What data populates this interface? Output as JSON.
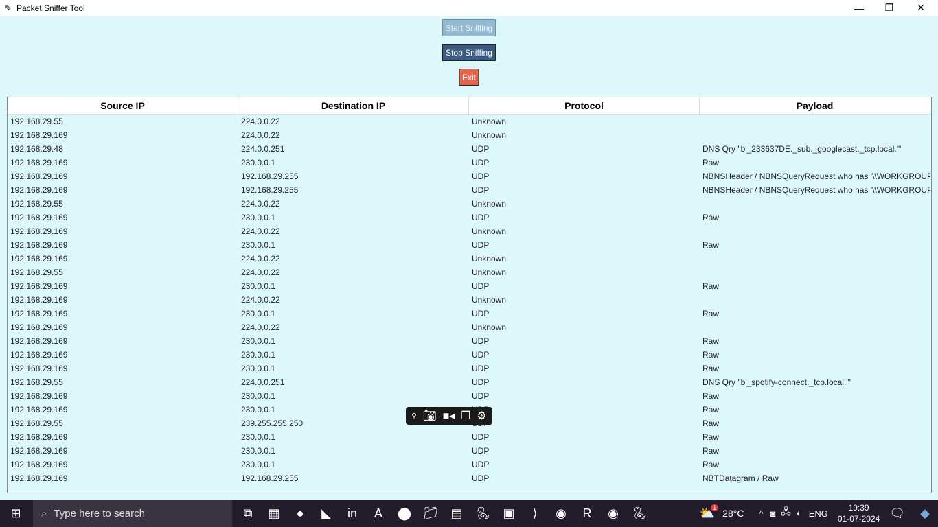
{
  "window": {
    "title": "Packet Sniffer Tool",
    "minimize": "—",
    "maximize": "❐",
    "close": "✕"
  },
  "buttons": {
    "start": "Start Sniffing",
    "stop": "Stop Sniffing",
    "exit": "Exit"
  },
  "colors": {
    "background": "#ddf8fb",
    "start": "#93bad3",
    "stop": "#3d5b80",
    "exit": "#e8654d"
  },
  "table": {
    "headers": [
      "Source IP",
      "Destination IP",
      "Protocol",
      "Payload"
    ],
    "rows": [
      [
        "192.168.29.55",
        "224.0.0.22",
        "Unknown",
        ""
      ],
      [
        "192.168.29.169",
        "224.0.0.22",
        "Unknown",
        ""
      ],
      [
        "192.168.29.48",
        "224.0.0.251",
        "UDP",
        "DNS Qry \"b'_233637DE._sub._googlecast._tcp.local.'\""
      ],
      [
        "192.168.29.169",
        "230.0.0.1",
        "UDP",
        "Raw"
      ],
      [
        "192.168.29.169",
        "192.168.29.255",
        "UDP",
        "NBNSHeader / NBNSQueryRequest who has '\\\\WORKGROUP'"
      ],
      [
        "192.168.29.169",
        "192.168.29.255",
        "UDP",
        "NBNSHeader / NBNSQueryRequest who has '\\\\WORKGROUP'"
      ],
      [
        "192.168.29.55",
        "224.0.0.22",
        "Unknown",
        ""
      ],
      [
        "192.168.29.169",
        "230.0.0.1",
        "UDP",
        "Raw"
      ],
      [
        "192.168.29.169",
        "224.0.0.22",
        "Unknown",
        ""
      ],
      [
        "192.168.29.169",
        "230.0.0.1",
        "UDP",
        "Raw"
      ],
      [
        "192.168.29.169",
        "224.0.0.22",
        "Unknown",
        ""
      ],
      [
        "192.168.29.55",
        "224.0.0.22",
        "Unknown",
        ""
      ],
      [
        "192.168.29.169",
        "230.0.0.1",
        "UDP",
        "Raw"
      ],
      [
        "192.168.29.169",
        "224.0.0.22",
        "Unknown",
        ""
      ],
      [
        "192.168.29.169",
        "230.0.0.1",
        "UDP",
        "Raw"
      ],
      [
        "192.168.29.169",
        "224.0.0.22",
        "Unknown",
        ""
      ],
      [
        "192.168.29.169",
        "230.0.0.1",
        "UDP",
        "Raw"
      ],
      [
        "192.168.29.169",
        "230.0.0.1",
        "UDP",
        "Raw"
      ],
      [
        "192.168.29.169",
        "230.0.0.1",
        "UDP",
        "Raw"
      ],
      [
        "192.168.29.55",
        "224.0.0.251",
        "UDP",
        "DNS Qry \"b'_spotify-connect._tcp.local.'\""
      ],
      [
        "192.168.29.169",
        "230.0.0.1",
        "UDP",
        "Raw"
      ],
      [
        "192.168.29.169",
        "230.0.0.1",
        "UDP",
        "Raw"
      ],
      [
        "192.168.29.55",
        "239.255.255.250",
        "UDP",
        "Raw"
      ],
      [
        "192.168.29.169",
        "230.0.0.1",
        "UDP",
        "Raw"
      ],
      [
        "192.168.29.169",
        "230.0.0.1",
        "UDP",
        "Raw"
      ],
      [
        "192.168.29.169",
        "230.0.0.1",
        "UDP",
        "Raw"
      ],
      [
        "192.168.29.169",
        "192.168.29.255",
        "UDP",
        "NBTDatagram / Raw"
      ]
    ]
  },
  "taskbar": {
    "search_placeholder": "Type here to search",
    "apps": [
      "task-view",
      "store",
      "spotify",
      "valorant",
      "linkedin",
      "app",
      "record",
      "file-explorer",
      "app2",
      "python",
      "app3",
      "vscode",
      "chrome",
      "app4",
      "chrome2",
      "python-idle"
    ],
    "weather": "28°C",
    "weather_badge": "1",
    "language": "ENG",
    "time": "19:39",
    "date": "01-07-2024"
  }
}
